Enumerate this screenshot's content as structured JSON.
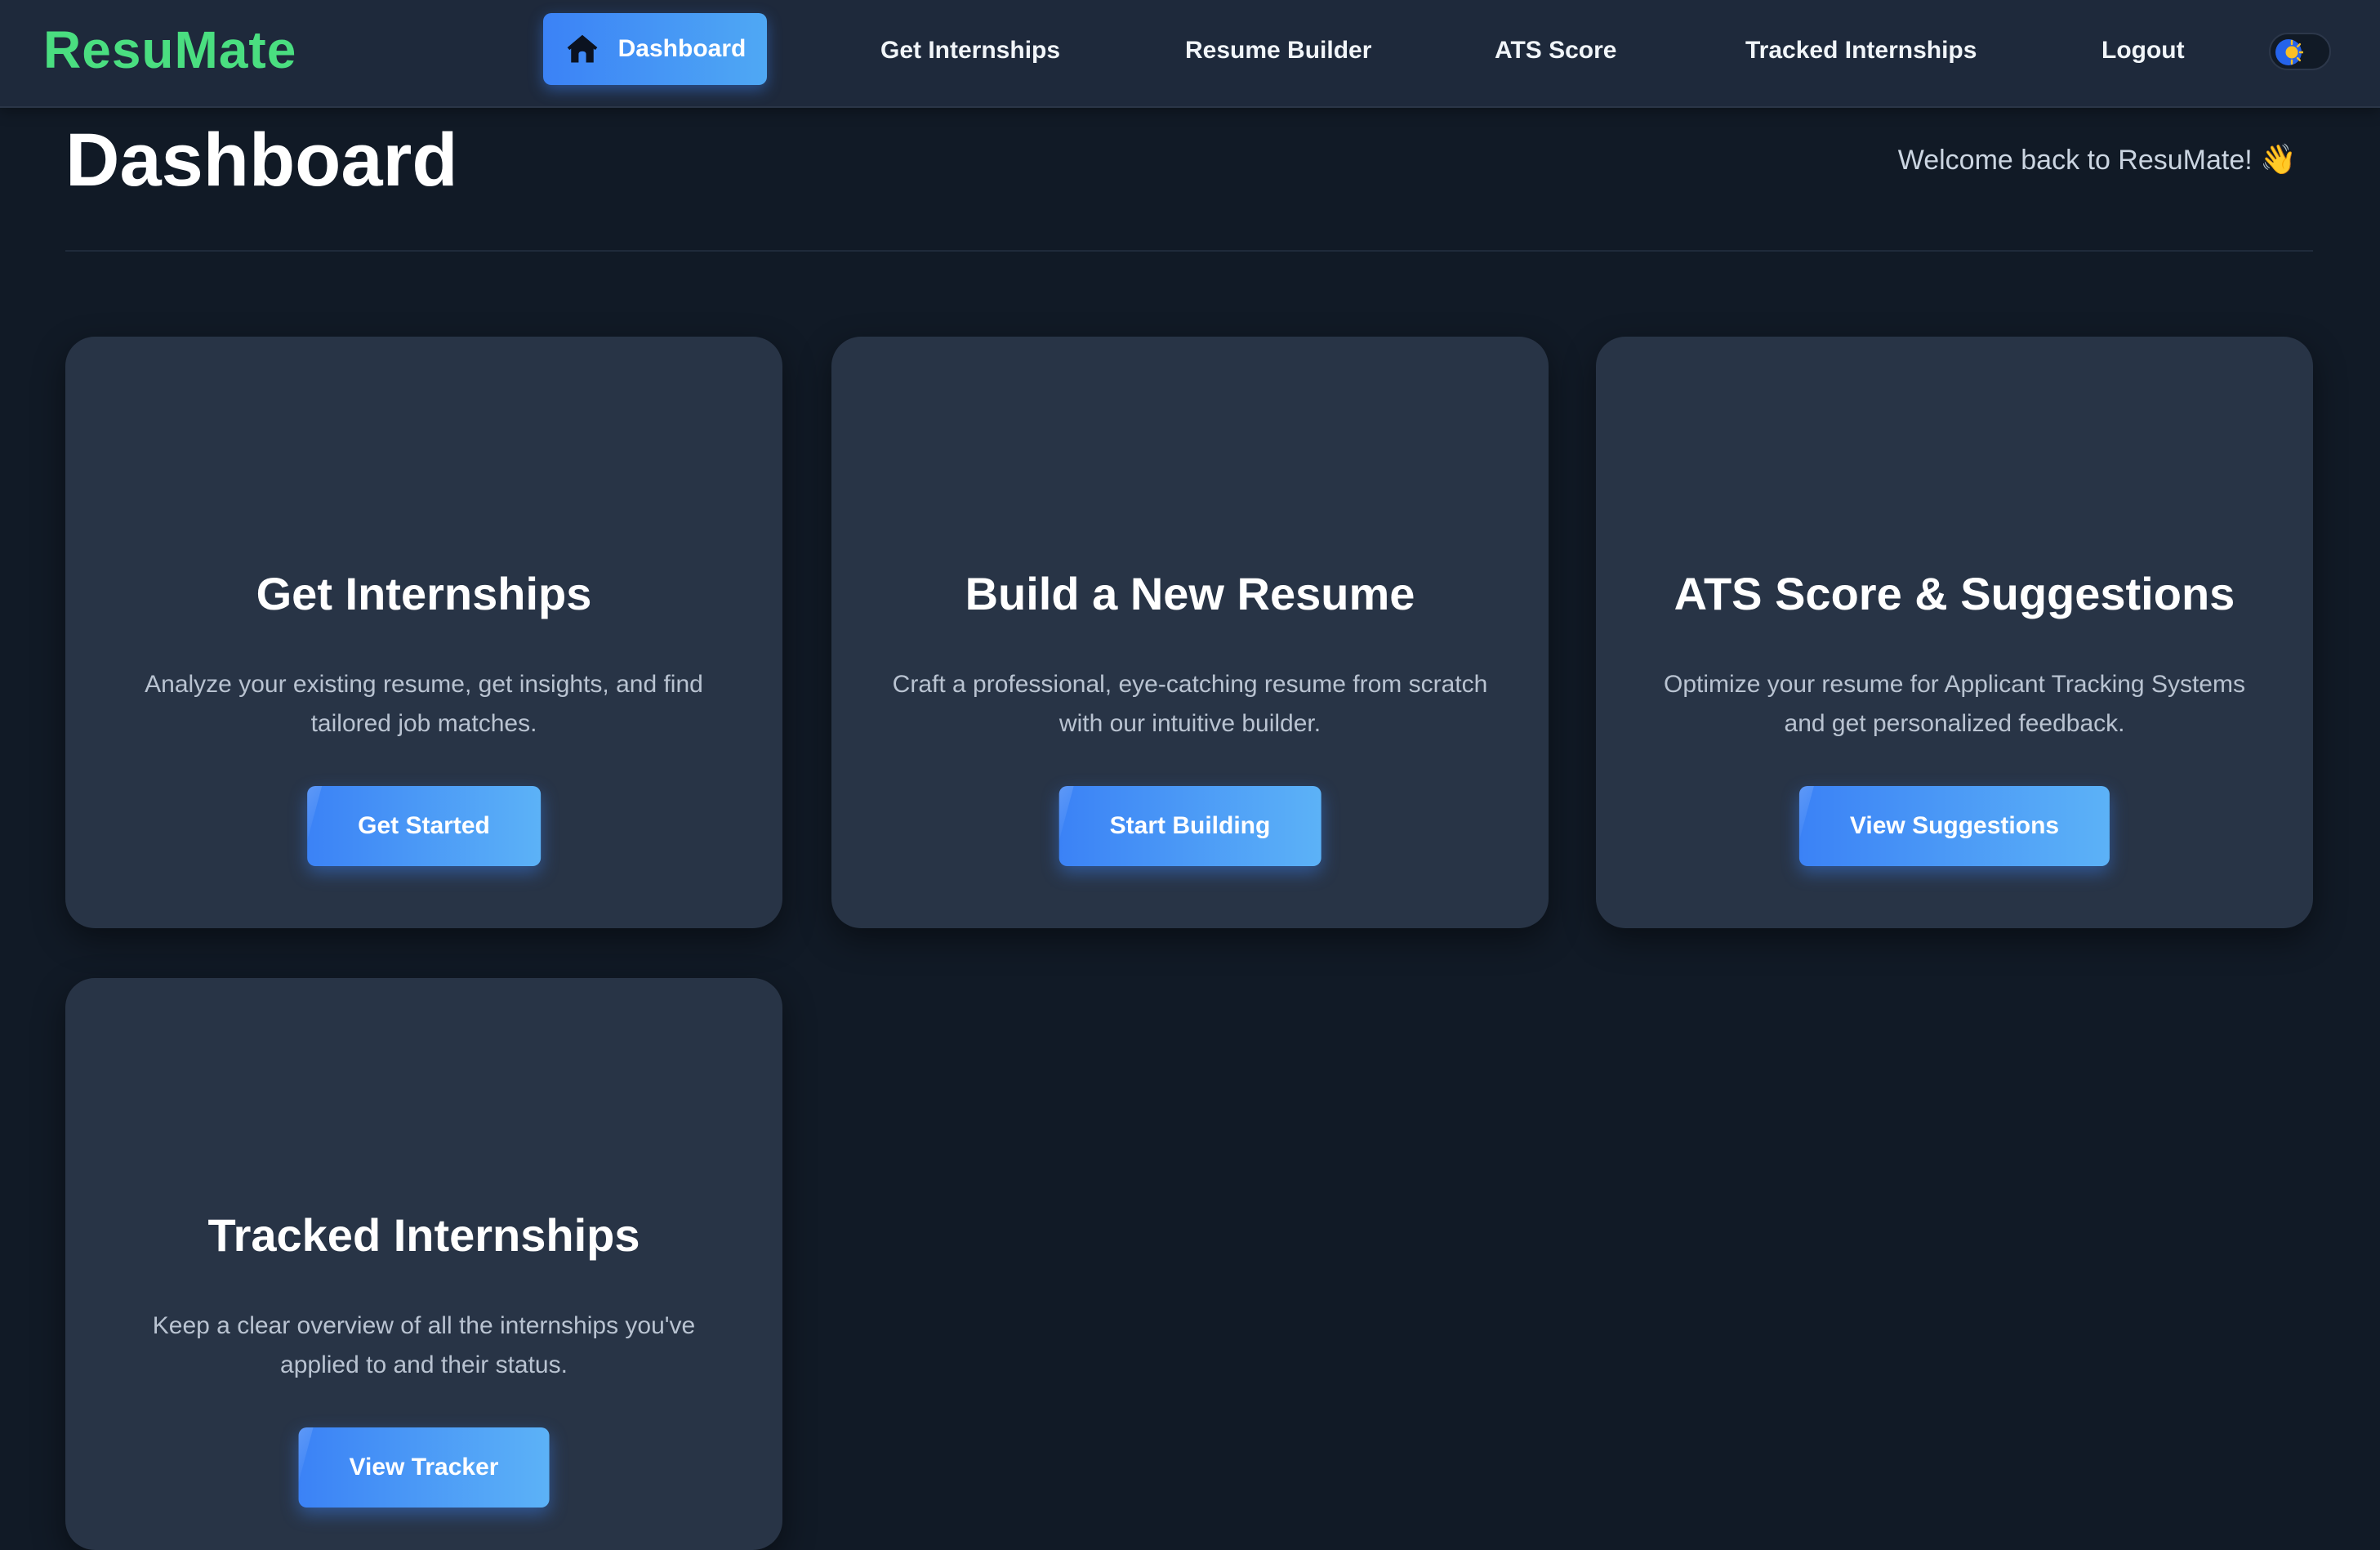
{
  "nav": {
    "logo": "ResuMate",
    "items": [
      {
        "label": "Dashboard",
        "icon": "home-icon",
        "active": true
      },
      {
        "label": "Get Internships"
      },
      {
        "label": "Resume Builder"
      },
      {
        "label": "ATS Score"
      },
      {
        "label": "Tracked Internships"
      },
      {
        "label": "Logout"
      }
    ],
    "theme_toggle_icon": "sun-icon"
  },
  "header": {
    "title": "Dashboard",
    "welcome": "Welcome back to ResuMate!",
    "welcome_emoji": "👋"
  },
  "cards": [
    {
      "title": "Get Internships",
      "description": "Analyze your existing resume, get insights, and find tailored job matches.",
      "button": "Get Started"
    },
    {
      "title": "Build a New Resume",
      "description": "Craft a professional, eye-catching resume from scratch with our intuitive builder.",
      "button": "Start Building"
    },
    {
      "title": "ATS Score & Suggestions",
      "description": "Optimize your resume for Applicant Tracking Systems and get personalized feedback.",
      "button": "View Suggestions"
    },
    {
      "title": "Tracked Internships",
      "description": "Keep a clear overview of all the internships you've applied to and their status.",
      "button": "View Tracker"
    }
  ],
  "colors": {
    "background": "#111a26",
    "navbar": "#1e293b",
    "card": "#283446",
    "logo": "#4ade80",
    "accent": "#3b82f6"
  }
}
